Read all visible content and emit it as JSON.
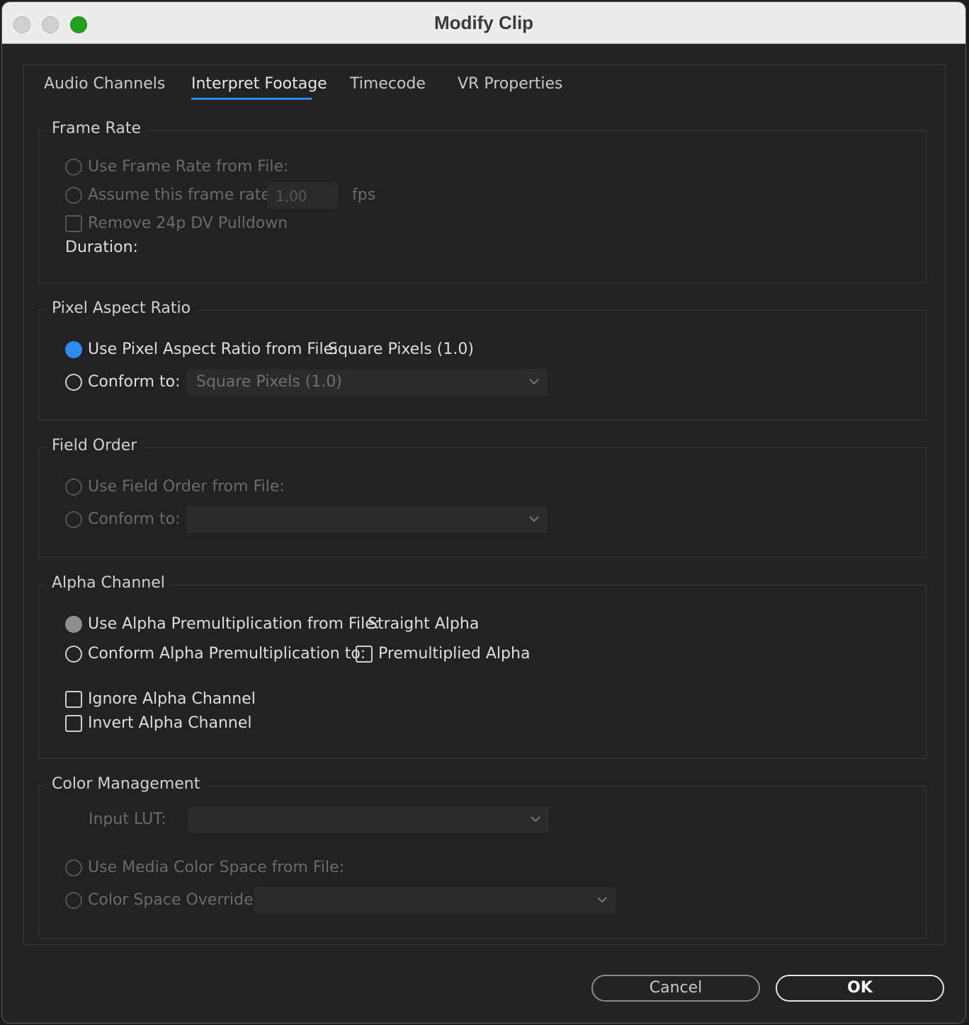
{
  "window": {
    "title": "Modify Clip"
  },
  "tabs": [
    {
      "label": "Audio Channels"
    },
    {
      "label": "Interpret Footage"
    },
    {
      "label": "Timecode"
    },
    {
      "label": "VR Properties"
    }
  ],
  "frame_rate": {
    "legend": "Frame Rate",
    "use_from_file": "Use Frame Rate from File:",
    "assume_rate": "Assume this frame rate:",
    "rate_value": "1,00",
    "fps": "fps",
    "remove_pulldown": "Remove 24p DV Pulldown",
    "duration": "Duration:"
  },
  "pixel_aspect": {
    "legend": "Pixel Aspect Ratio",
    "use_from_file": "Use Pixel Aspect Ratio from File:",
    "file_value": "Square Pixels (1.0)",
    "conform_to": "Conform to:",
    "conform_value": "Square Pixels (1.0)"
  },
  "field_order": {
    "legend": "Field Order",
    "use_from_file": "Use Field Order from File:",
    "conform_to": "Conform to:"
  },
  "alpha": {
    "legend": "Alpha Channel",
    "use_from_file": "Use Alpha Premultiplication from File:",
    "file_value": "Straight Alpha",
    "conform_to": "Conform Alpha Premultiplication to:",
    "premultiplied": "Premultiplied Alpha",
    "ignore": "Ignore Alpha Channel",
    "invert": "Invert Alpha Channel"
  },
  "color": {
    "legend": "Color Management",
    "input_lut": "Input LUT:",
    "use_media": "Use Media Color Space from File:",
    "override": "Color Space Override:"
  },
  "buttons": {
    "cancel": "Cancel",
    "ok": "OK"
  },
  "colors": {
    "accent": "#2d8ceb",
    "window_bg": "#232323"
  }
}
